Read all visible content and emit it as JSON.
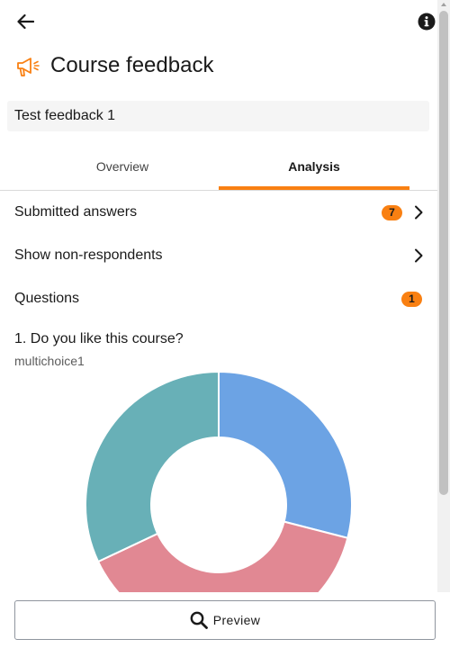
{
  "header": {
    "back_icon": "arrow-left-icon",
    "info_icon": "info-circle-icon"
  },
  "page": {
    "title": "Course feedback",
    "title_icon": "megaphone-icon",
    "feedback_name": "Test feedback 1"
  },
  "tabs": [
    {
      "label": "Overview",
      "selected": false
    },
    {
      "label": "Analysis",
      "selected": true
    }
  ],
  "rows": {
    "submitted": {
      "label": "Submitted answers",
      "count": "7"
    },
    "nonrespondents": {
      "label": "Show non-respondents"
    },
    "questions": {
      "label": "Questions",
      "count": "1"
    }
  },
  "question": {
    "title": "1. Do you like this course?",
    "subtitle": "multichoice1"
  },
  "chart_data": {
    "type": "pie",
    "donut": true,
    "values": [
      29,
      39,
      32
    ],
    "colors": [
      "#6ca3e4",
      "#e18893",
      "#68b0b7"
    ]
  },
  "footer": {
    "preview_label": "Preview",
    "preview_icon": "search-icon"
  },
  "colors": {
    "accent": "#f98012"
  }
}
